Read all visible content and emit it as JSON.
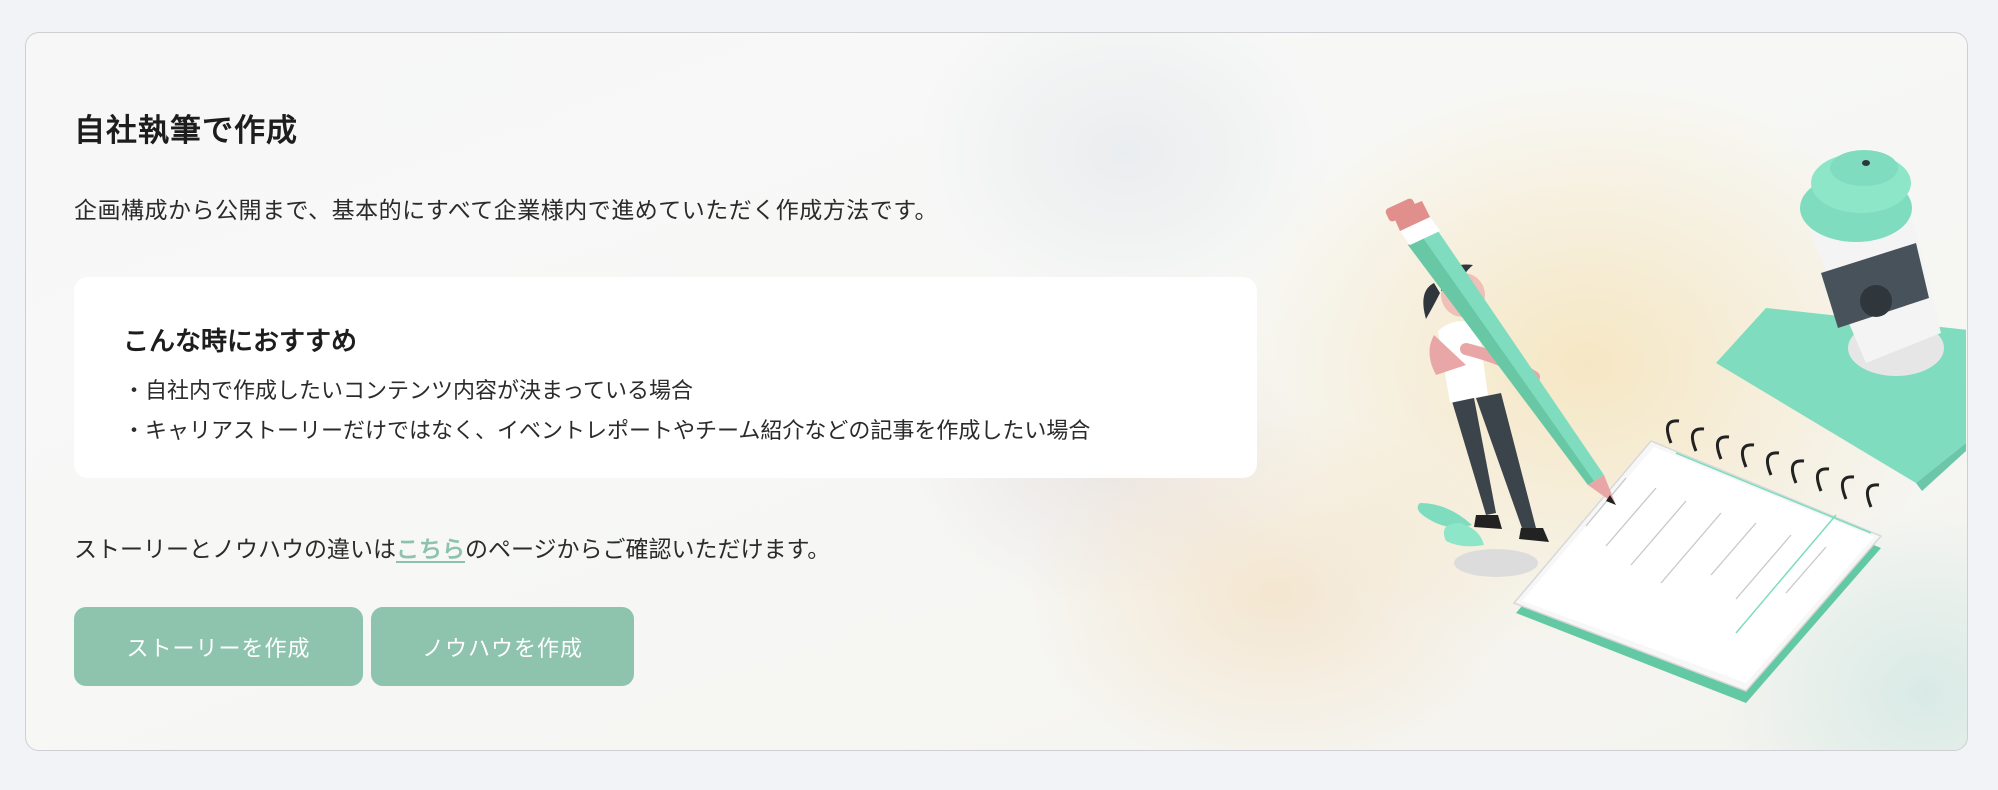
{
  "card": {
    "title": "自社執筆で作成",
    "description": "企画構成から公開まで、基本的にすべて企業様内で進めていただく作成方法です。"
  },
  "recommend": {
    "title": "こんな時におすすめ",
    "items": [
      "・自社内で作成したいコンテンツ内容が決まっている場合",
      "・キャリアストーリーだけではなく、イベントレポートやチーム紹介などの記事を作成したい場合"
    ]
  },
  "note": {
    "before": "ストーリーとノウハウの違いは",
    "link": "こちら",
    "after": "のページからご確認いただけます。"
  },
  "buttons": {
    "story": "ストーリーを作成",
    "knowhow": "ノウハウを作成"
  },
  "illustration": {
    "subject": "woman-with-pencil-notebook-coffee-illustration"
  },
  "colors": {
    "accent": "#8ec3ad",
    "mint": "#7fdcbe",
    "link": "#8dc3ac"
  }
}
